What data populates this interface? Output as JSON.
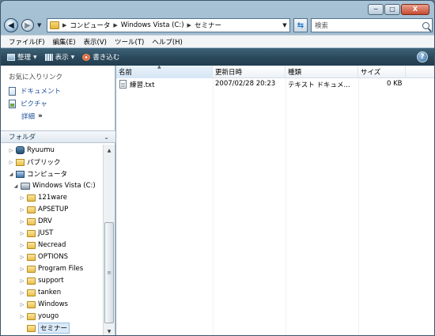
{
  "window": {
    "caption_buttons": {
      "minimize": "−",
      "maximize": "□",
      "close": "X"
    }
  },
  "address": {
    "crumbs": [
      "コンピュータ",
      "Windows Vista (C:)",
      "セミナー"
    ],
    "search_placeholder": "検索"
  },
  "menu": [
    "ファイル(F)",
    "編集(E)",
    "表示(V)",
    "ツール(T)",
    "ヘルプ(H)"
  ],
  "command_bar": {
    "organize": "整理",
    "view": "表示",
    "burn": "書き込む",
    "help": "?"
  },
  "favorites": {
    "title": "お気に入りリンク",
    "links": [
      "ドキュメント",
      "ピクチャ"
    ],
    "more": "詳細",
    "more_glyph": "»"
  },
  "folder_pane": {
    "title": "フォルダ",
    "tree": [
      {
        "label": "Ryuumu",
        "icon": "user-icon"
      },
      {
        "label": "パブリック",
        "icon": "public-folder-icon"
      },
      {
        "label": "コンピュータ",
        "icon": "computer-icon"
      },
      {
        "label": "Windows Vista (C:)",
        "icon": "drive-icon"
      },
      {
        "label": "121ware",
        "icon": "folder-icon"
      },
      {
        "label": "APSETUP",
        "icon": "folder-icon"
      },
      {
        "label": "DRV",
        "icon": "folder-icon"
      },
      {
        "label": "JUST",
        "icon": "folder-icon"
      },
      {
        "label": "Necread",
        "icon": "folder-icon"
      },
      {
        "label": "OPTIONS",
        "icon": "folder-icon"
      },
      {
        "label": "Program Files",
        "icon": "folder-icon"
      },
      {
        "label": "support",
        "icon": "folder-icon"
      },
      {
        "label": "tanken",
        "icon": "folder-icon"
      },
      {
        "label": "Windows",
        "icon": "folder-icon"
      },
      {
        "label": "yougo",
        "icon": "folder-icon"
      },
      {
        "label": "セミナー",
        "icon": "folder-icon",
        "selected": true
      }
    ]
  },
  "file_list": {
    "columns": [
      "名前",
      "更新日時",
      "種類",
      "サイズ"
    ],
    "rows": [
      {
        "name": "練習.txt",
        "modified": "2007/02/28 20:23",
        "type": "テキスト ドキュメ...",
        "size": "0 KB"
      }
    ]
  },
  "colors": {
    "command_bar": "#2c4a5d",
    "link": "#1f4f9c",
    "selection": "#dbeaf8"
  }
}
